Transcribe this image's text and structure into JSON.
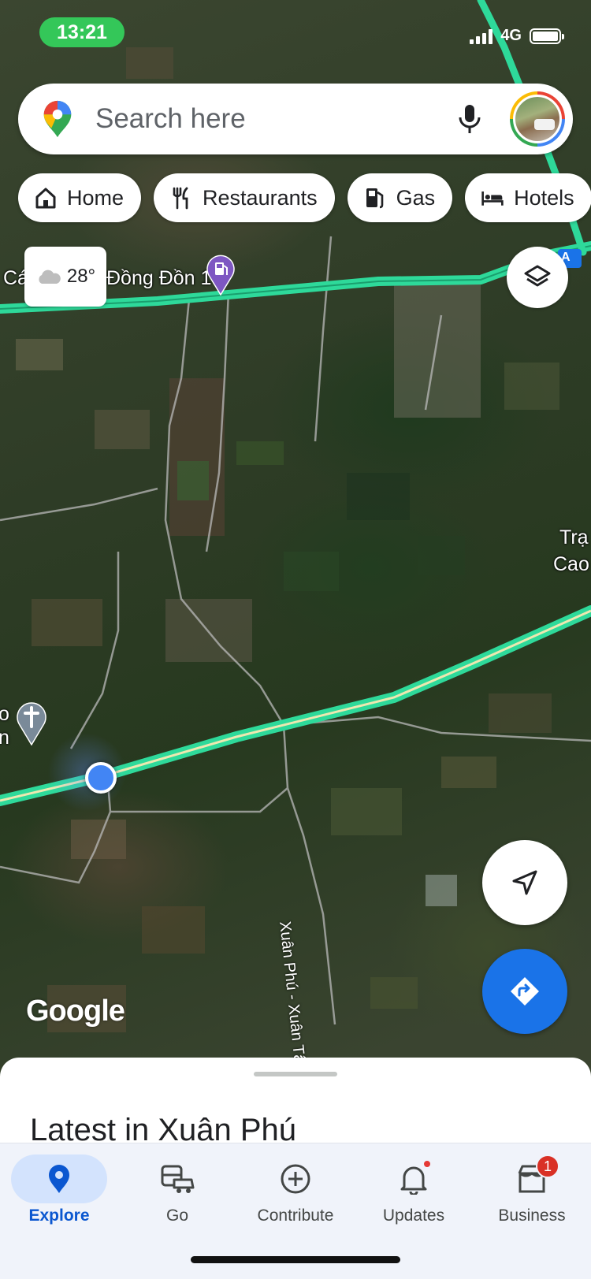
{
  "status_bar": {
    "time": "13:21",
    "network": "4G"
  },
  "search": {
    "placeholder": "Search here"
  },
  "chips": [
    {
      "label": "Home",
      "icon": "home-icon"
    },
    {
      "label": "Restaurants",
      "icon": "restaurant-icon"
    },
    {
      "label": "Gas",
      "icon": "gas-station-icon"
    },
    {
      "label": "Hotels",
      "icon": "hotel-icon"
    }
  ],
  "weather": {
    "temp": "28°",
    "icon": "cloud-icon"
  },
  "map": {
    "labels": {
      "gas_station_left": "Cá",
      "gas_station_right": "Đồng Đồn 1",
      "place_right_1": "Trạ",
      "place_right_2": "Cao",
      "church_line_1": "o",
      "church_line_2": "n",
      "road": "Xuân Phú - Xuân Tây",
      "highway_tag": "A"
    },
    "attribution": "Google"
  },
  "sheet": {
    "title": "Latest in Xuân Phú"
  },
  "bottom_nav": [
    {
      "label": "Explore",
      "icon": "explore-pin-icon",
      "active": true
    },
    {
      "label": "Go",
      "icon": "commute-icon",
      "active": false
    },
    {
      "label": "Contribute",
      "icon": "add-circle-icon",
      "active": false
    },
    {
      "label": "Updates",
      "icon": "bell-icon",
      "active": false
    },
    {
      "label": "Business",
      "icon": "store-icon",
      "active": false,
      "badge": "1"
    }
  ],
  "colors": {
    "accent": "#1a73e8",
    "route": "#2ed99a",
    "active_nav_bg": "#d3e3fd",
    "status_pill": "#34c759"
  }
}
